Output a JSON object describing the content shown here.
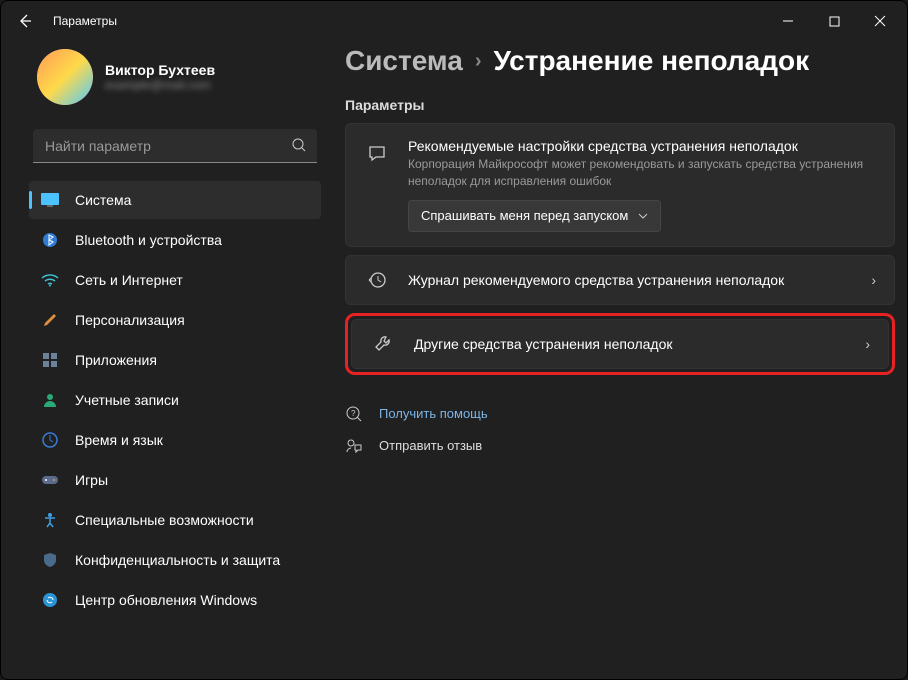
{
  "window": {
    "title": "Параметры"
  },
  "user": {
    "name": "Виктор Бухтеев",
    "email": "example@mail.com"
  },
  "search": {
    "placeholder": "Найти параметр"
  },
  "sidebar": {
    "items": [
      {
        "label": "Система"
      },
      {
        "label": "Bluetooth и устройства"
      },
      {
        "label": "Сеть и Интернет"
      },
      {
        "label": "Персонализация"
      },
      {
        "label": "Приложения"
      },
      {
        "label": "Учетные записи"
      },
      {
        "label": "Время и язык"
      },
      {
        "label": "Игры"
      },
      {
        "label": "Специальные возможности"
      },
      {
        "label": "Конфиденциальность и защита"
      },
      {
        "label": "Центр обновления Windows"
      }
    ]
  },
  "breadcrumb": {
    "parent": "Система",
    "current": "Устранение неполадок"
  },
  "section_label": "Параметры",
  "recommended": {
    "title": "Рекомендуемые настройки средства устранения неполадок",
    "desc": "Корпорация Майкрософт может рекомендовать и запускать средства устранения неполадок для исправления ошибок",
    "dropdown": "Спрашивать меня перед запуском"
  },
  "cards": {
    "history": "Журнал рекомендуемого средства устранения неполадок",
    "other": "Другие средства устранения неполадок"
  },
  "links": {
    "help": "Получить помощь",
    "feedback": "Отправить отзыв"
  }
}
